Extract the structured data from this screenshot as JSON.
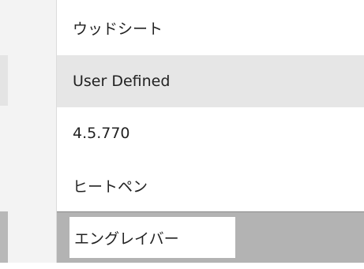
{
  "list": {
    "items": [
      {
        "label": "ウッドシート"
      },
      {
        "label": "User Defined"
      },
      {
        "label": "4.5.770"
      },
      {
        "label": "ヒートペン"
      },
      {
        "label": "エングレイバー"
      }
    ]
  }
}
